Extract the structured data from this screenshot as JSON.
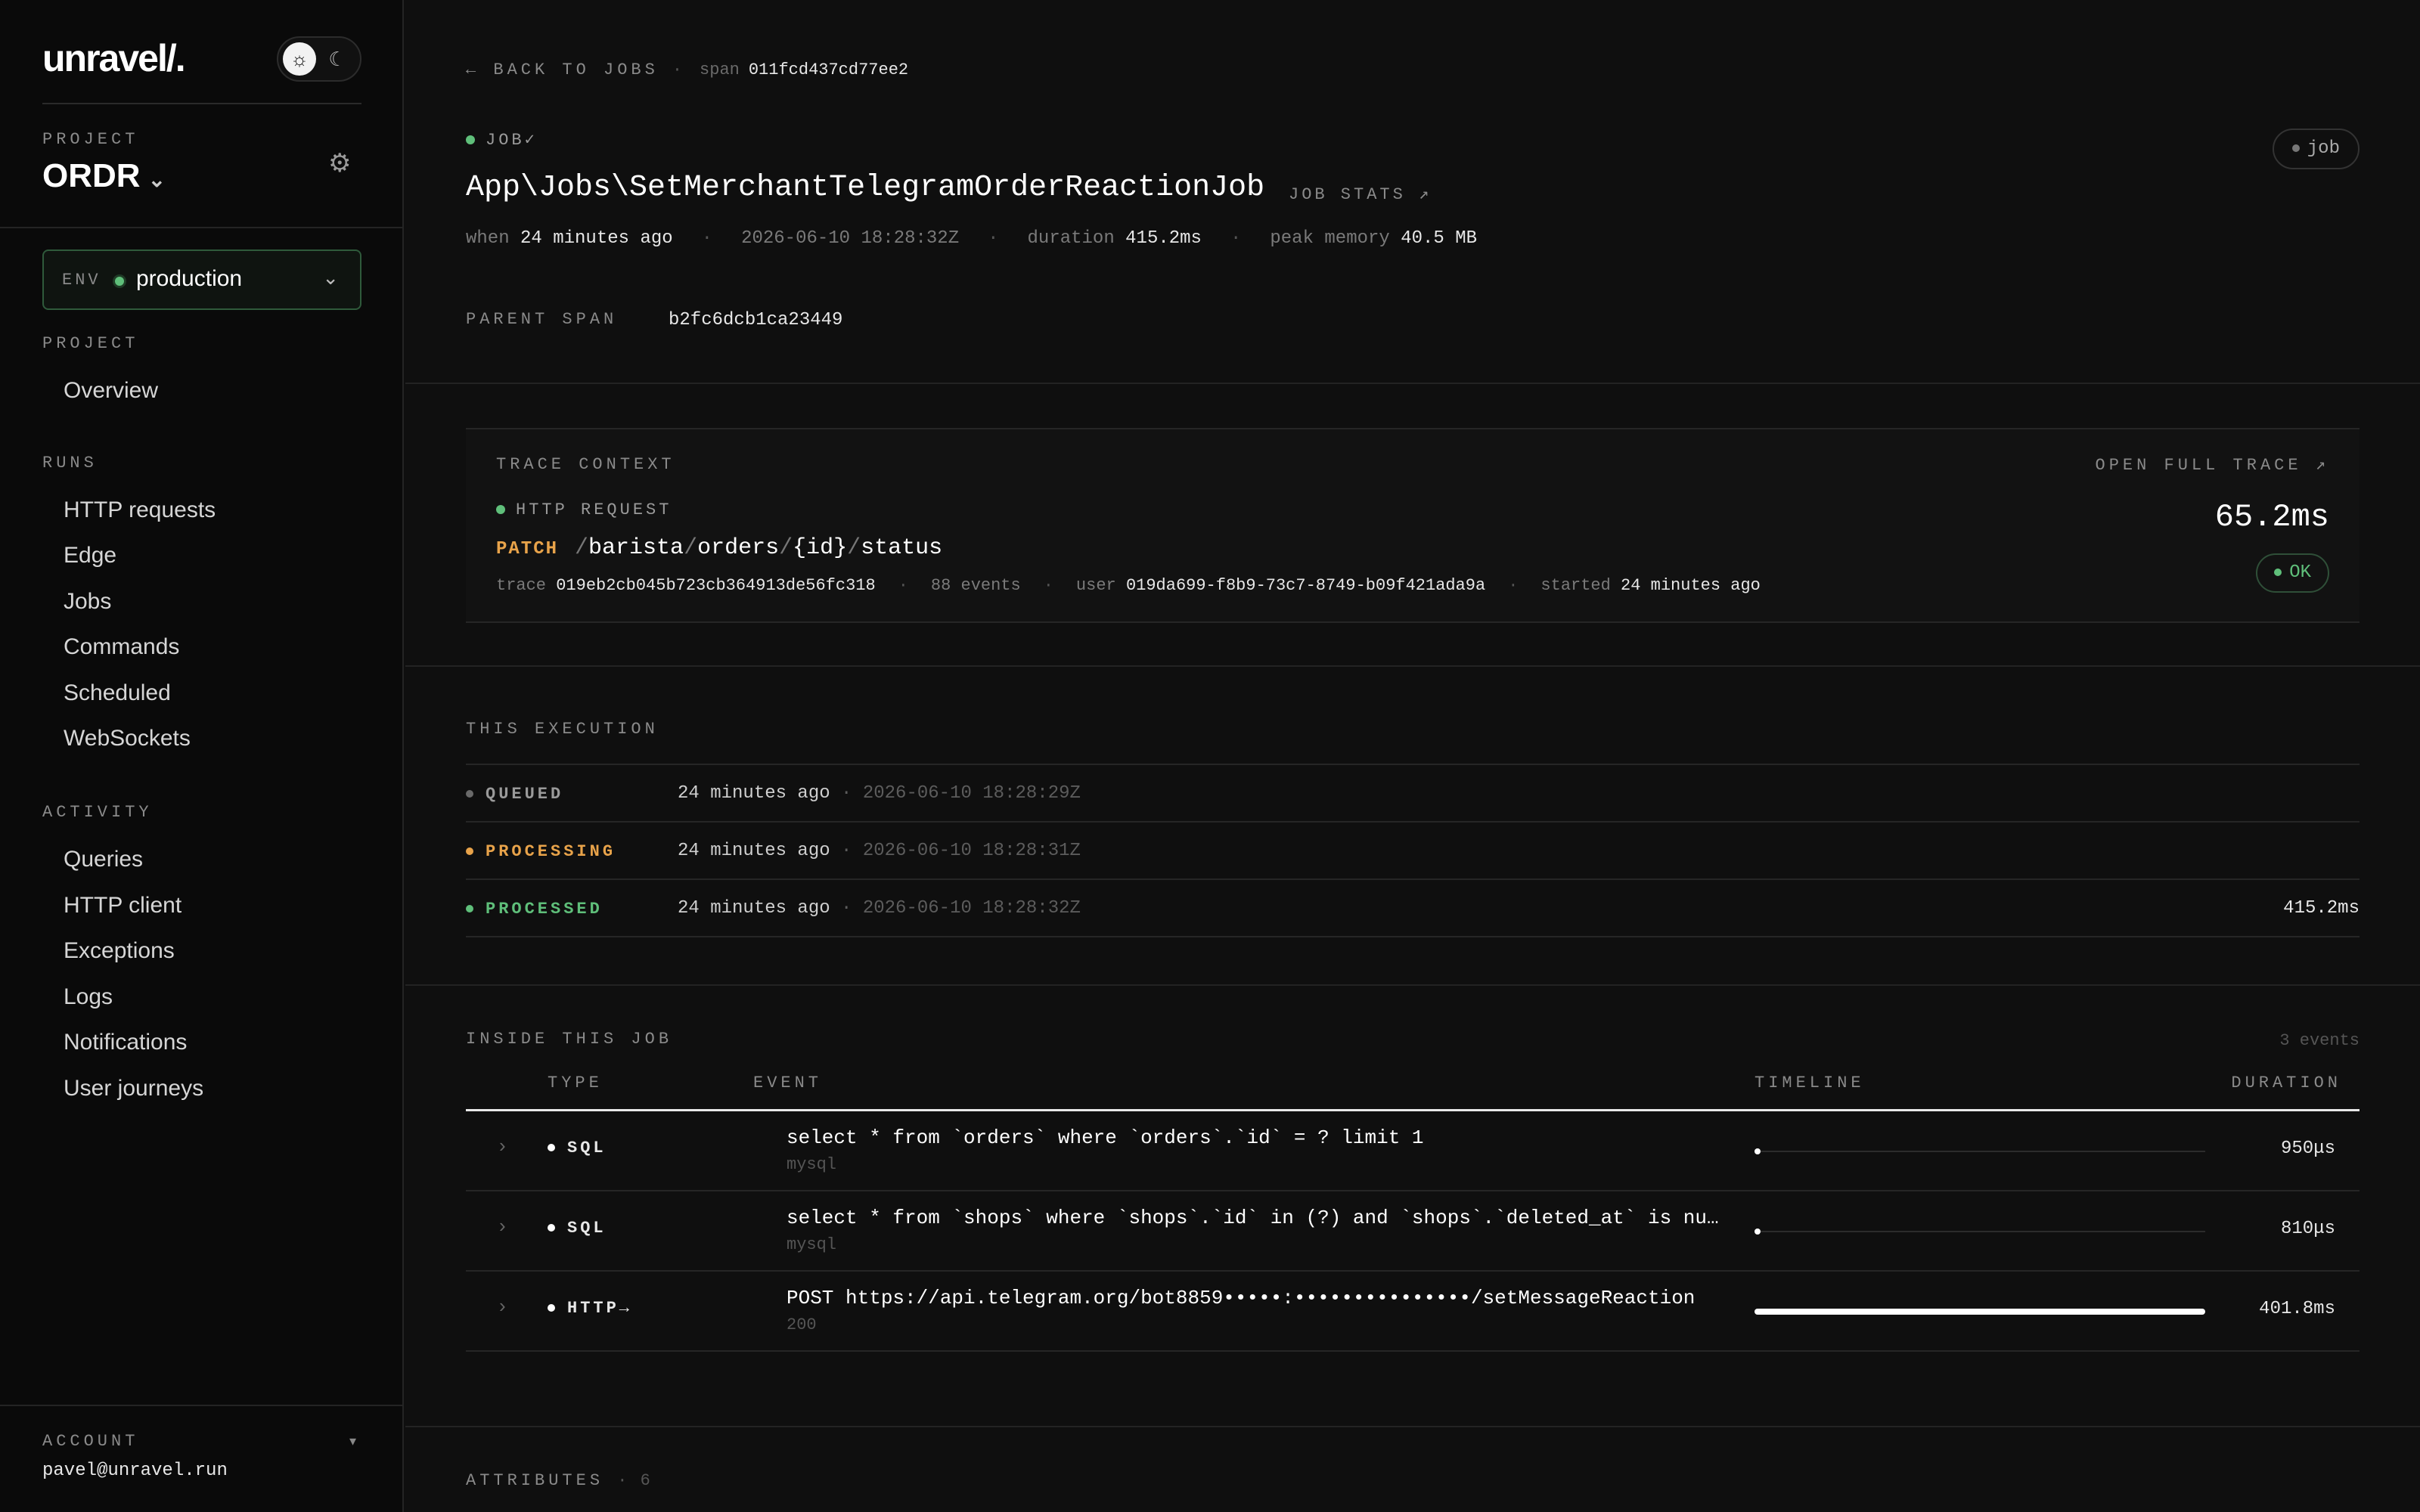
{
  "sidebar": {
    "logo": "unravel/.",
    "theme": {
      "light_icon": "sun-icon",
      "dark_icon": "moon-icon"
    },
    "project_label": "PROJECT",
    "project_name": "ORDR",
    "env": {
      "label": "ENV",
      "value": "production",
      "status_color": "#5fbf7a"
    },
    "project_section": "PROJECT",
    "project_items": [
      {
        "label": "Overview"
      }
    ],
    "runs_section": "RUNS",
    "runs_items": [
      {
        "label": "HTTP requests"
      },
      {
        "label": "Edge"
      },
      {
        "label": "Jobs"
      },
      {
        "label": "Commands"
      },
      {
        "label": "Scheduled"
      },
      {
        "label": "WebSockets"
      }
    ],
    "activity_section": "ACTIVITY",
    "activity_items": [
      {
        "label": "Queries"
      },
      {
        "label": "HTTP client"
      },
      {
        "label": "Exceptions"
      },
      {
        "label": "Logs"
      },
      {
        "label": "Notifications"
      },
      {
        "label": "User journeys"
      }
    ],
    "account": {
      "label": "ACCOUNT",
      "email": "pavel@unravel.run"
    }
  },
  "header": {
    "back_label": "← BACK TO JOBS",
    "span_label": "span",
    "span_id": "011fcd437cd77ee2",
    "kind_label": "JOB✓",
    "badge": "job",
    "title": "App\\Jobs\\SetMerchantTelegramOrderReactionJob",
    "job_stats_link": "JOB STATS ↗",
    "meta": {
      "when_label": "when",
      "when_value": "24 minutes ago",
      "timestamp": "2026-06-10 18:28:32Z",
      "duration_label": "duration",
      "duration_value": "415.2ms",
      "memory_label": "peak memory",
      "memory_value": "40.5 MB"
    },
    "parent_span_label": "PARENT SPAN",
    "parent_span_value": "b2fc6dcb1ca23449"
  },
  "trace": {
    "label": "TRACE CONTEXT",
    "open_link": "OPEN FULL TRACE ↗",
    "kind": "HTTP REQUEST",
    "method": "PATCH",
    "route_parts": [
      "/",
      "barista",
      "/",
      "orders",
      "/",
      "{id}",
      "/",
      "status"
    ],
    "trace_label": "trace",
    "trace_id": "019eb2cb045b723cb364913de56fc318",
    "events": "88 events",
    "user_label": "user",
    "user_id": "019da699-f8b9-73c7-8749-b09f421ada9a",
    "started_label": "started",
    "started_value": "24 minutes ago",
    "duration": "65.2ms",
    "status": "OK"
  },
  "execution": {
    "label": "THIS EXECUTION",
    "rows": [
      {
        "state": "QUEUED",
        "color": "#7a7a7a",
        "when": "24 minutes ago",
        "ts": "· 2026-06-10 18:28:29Z",
        "duration": ""
      },
      {
        "state": "PROCESSING",
        "color": "#e8a34a",
        "when": "24 minutes ago",
        "ts": "· 2026-06-10 18:28:31Z",
        "duration": ""
      },
      {
        "state": "PROCESSED",
        "color": "#5fbf7a",
        "when": "24 minutes ago",
        "ts": "· 2026-06-10 18:28:32Z",
        "duration": "415.2ms"
      }
    ]
  },
  "events": {
    "label": "INSIDE THIS JOB",
    "count": "3 events",
    "columns": {
      "type": "TYPE",
      "event": "EVENT",
      "timeline": "TIMELINE",
      "duration": "DURATION"
    },
    "rows": [
      {
        "type": "SQL",
        "event": "select * from `orders` where `orders`.`id` = ? limit 1",
        "sub": "mysql",
        "duration": "950μs",
        "offset": 0.0,
        "fraction": 0.0023
      },
      {
        "type": "SQL",
        "event": "select * from `shops` where `shops`.`id` in (?) and `shops`.`deleted_at` is null",
        "sub": "mysql",
        "duration": "810μs",
        "offset": 0.0,
        "fraction": 0.002
      },
      {
        "type": "HTTP→",
        "event": "POST https://api.telegram.org/bot8859•••••:•••••••••••••••/setMessageReaction",
        "sub": "200",
        "duration": "401.8ms",
        "offset": 0.0,
        "fraction": 1.0
      }
    ]
  },
  "attributes": {
    "label": "ATTRIBUTES",
    "count": "· 6"
  }
}
